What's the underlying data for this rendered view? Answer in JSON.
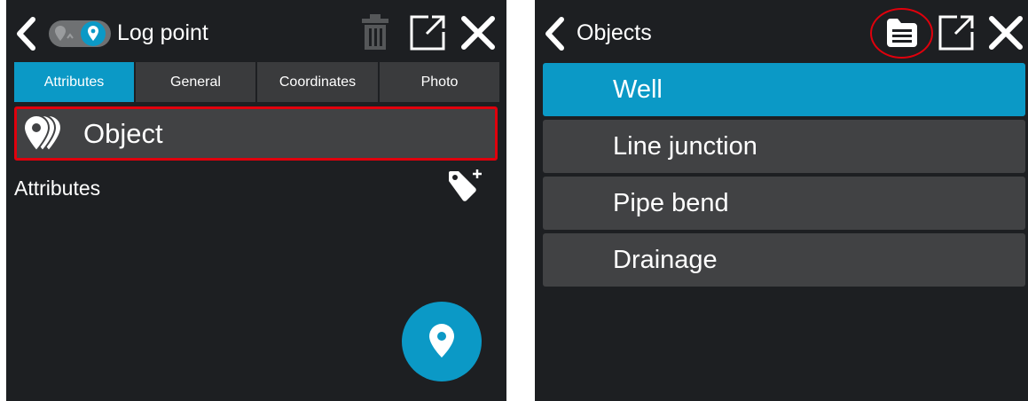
{
  "log_point_screen": {
    "title": "Log point",
    "tabs": [
      {
        "label": "Attributes",
        "active": true
      },
      {
        "label": "General",
        "active": false
      },
      {
        "label": "Coordinates",
        "active": false
      },
      {
        "label": "Photo",
        "active": false
      }
    ],
    "object_label": "Object",
    "attributes_label": "Attributes"
  },
  "objects_screen": {
    "title": "Objects",
    "items": [
      {
        "label": "Well",
        "selected": true
      },
      {
        "label": "Line junction",
        "selected": false
      },
      {
        "label": "Pipe bend",
        "selected": false
      },
      {
        "label": "Drainage",
        "selected": false
      }
    ]
  },
  "colors": {
    "background": "#1d1f22",
    "accent": "#0b99c6",
    "row": "#414244",
    "tab": "#3a3b3d",
    "highlight": "#e0000c",
    "disabled_icon": "#555759"
  },
  "icons": [
    "back-icon",
    "map-pin-toggle-icon",
    "trash-icon",
    "external-link-icon",
    "close-icon",
    "object-stack-icon",
    "tag-add-icon",
    "location-pin-icon",
    "list-menu-icon"
  ]
}
